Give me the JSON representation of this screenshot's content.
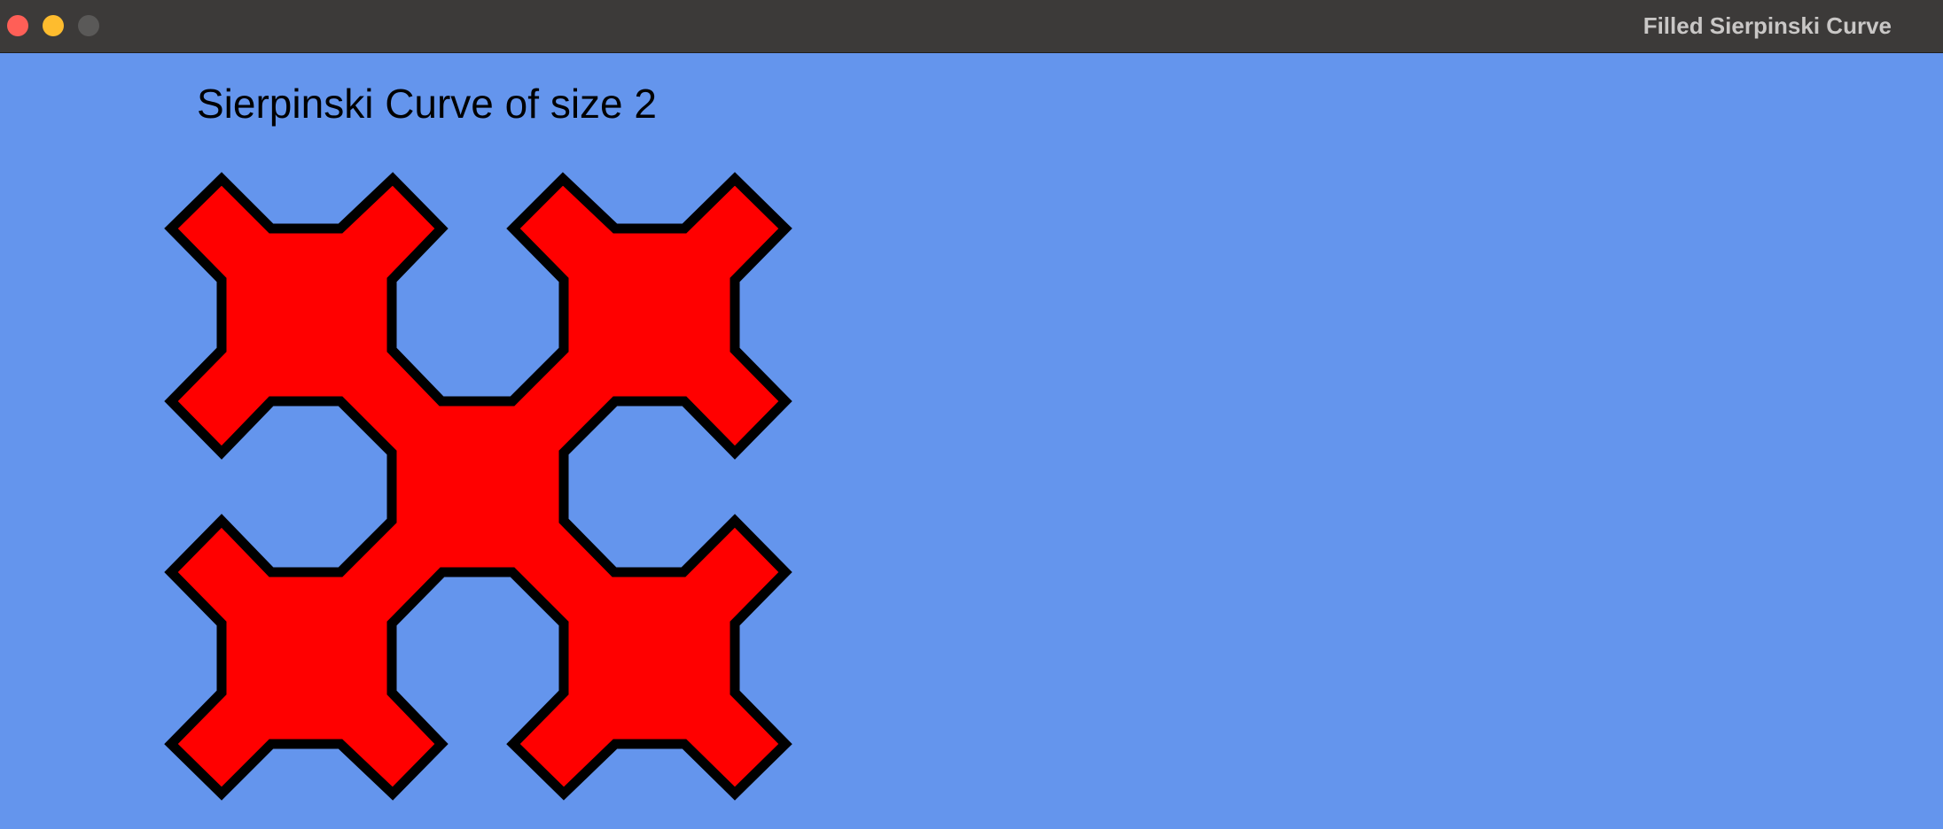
{
  "window": {
    "title": "Filled Sierpinski Curve",
    "controls": {
      "close_color": "#ff5f57",
      "minimize_color": "#febc2e",
      "maximize_color": "#5a5958"
    }
  },
  "canvas": {
    "background": "#6495ED",
    "heading": "Sierpinski Curve of size 2",
    "curve": {
      "size": 2,
      "fill": "#FF0000",
      "stroke": "#000000"
    }
  }
}
